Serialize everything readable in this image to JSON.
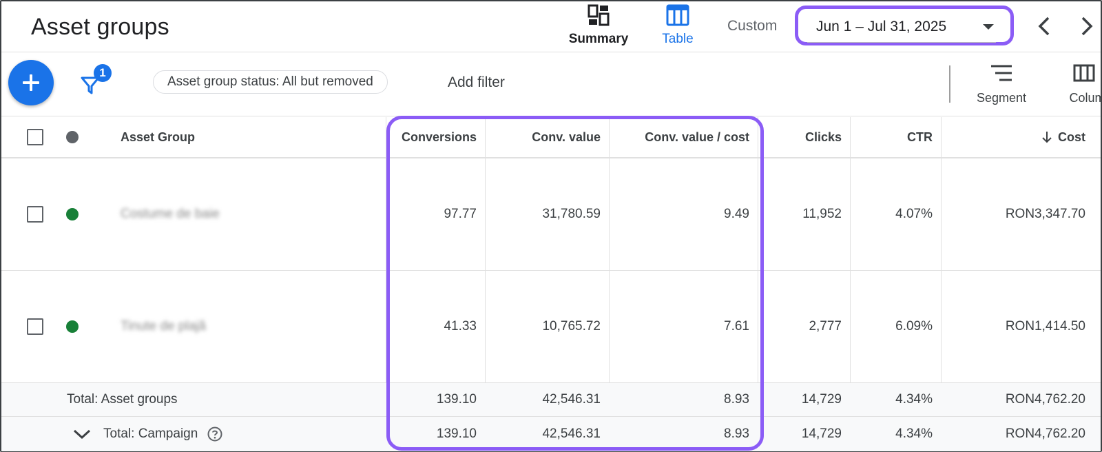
{
  "header": {
    "title": "Asset groups",
    "views": [
      {
        "label": "Summary",
        "icon": "summary-dashboard-icon",
        "active": false
      },
      {
        "label": "Table",
        "icon": "table-icon",
        "active": true
      }
    ],
    "date_range_type": "Custom",
    "date_range": "Jun 1 – Jul 31, 2025",
    "accent_color": "#1a73e8",
    "highlight_color": "#8b5cf6"
  },
  "toolbar": {
    "filter_count": "1",
    "status_chip": "Asset group status: All but removed",
    "add_filter": "Add filter",
    "segment_label": "Segment",
    "columns_label": "Columns"
  },
  "table": {
    "columns": {
      "asset_group": "Asset Group",
      "conversions": "Conversions",
      "conv_value": "Conv. value",
      "conv_value_cost": "Conv. value / cost",
      "clicks": "Clicks",
      "ctr": "CTR",
      "cost": "Cost"
    },
    "cost_sort": "descending",
    "rows": [
      {
        "name": "Costume de baie",
        "status_color": "#188038",
        "conversions": "97.77",
        "conv_value": "31,780.59",
        "conv_value_cost": "9.49",
        "clicks": "11,952",
        "ctr": "4.07%",
        "cost": "RON3,347.70"
      },
      {
        "name": "Tinute de plajă",
        "status_color": "#188038",
        "conversions": "41.33",
        "conv_value": "10,765.72",
        "conv_value_cost": "7.61",
        "clicks": "2,777",
        "ctr": "6.09%",
        "cost": "RON1,414.50"
      }
    ],
    "totals": [
      {
        "label": "Total: Asset groups",
        "conversions": "139.10",
        "conv_value": "42,546.31",
        "conv_value_cost": "8.93",
        "clicks": "14,729",
        "ctr": "4.34%",
        "cost": "RON4,762.20"
      },
      {
        "label": "Total: Campaign",
        "conversions": "139.10",
        "conv_value": "42,546.31",
        "conv_value_cost": "8.93",
        "clicks": "14,729",
        "ctr": "4.34%",
        "cost": "RON4,762.20"
      }
    ]
  }
}
